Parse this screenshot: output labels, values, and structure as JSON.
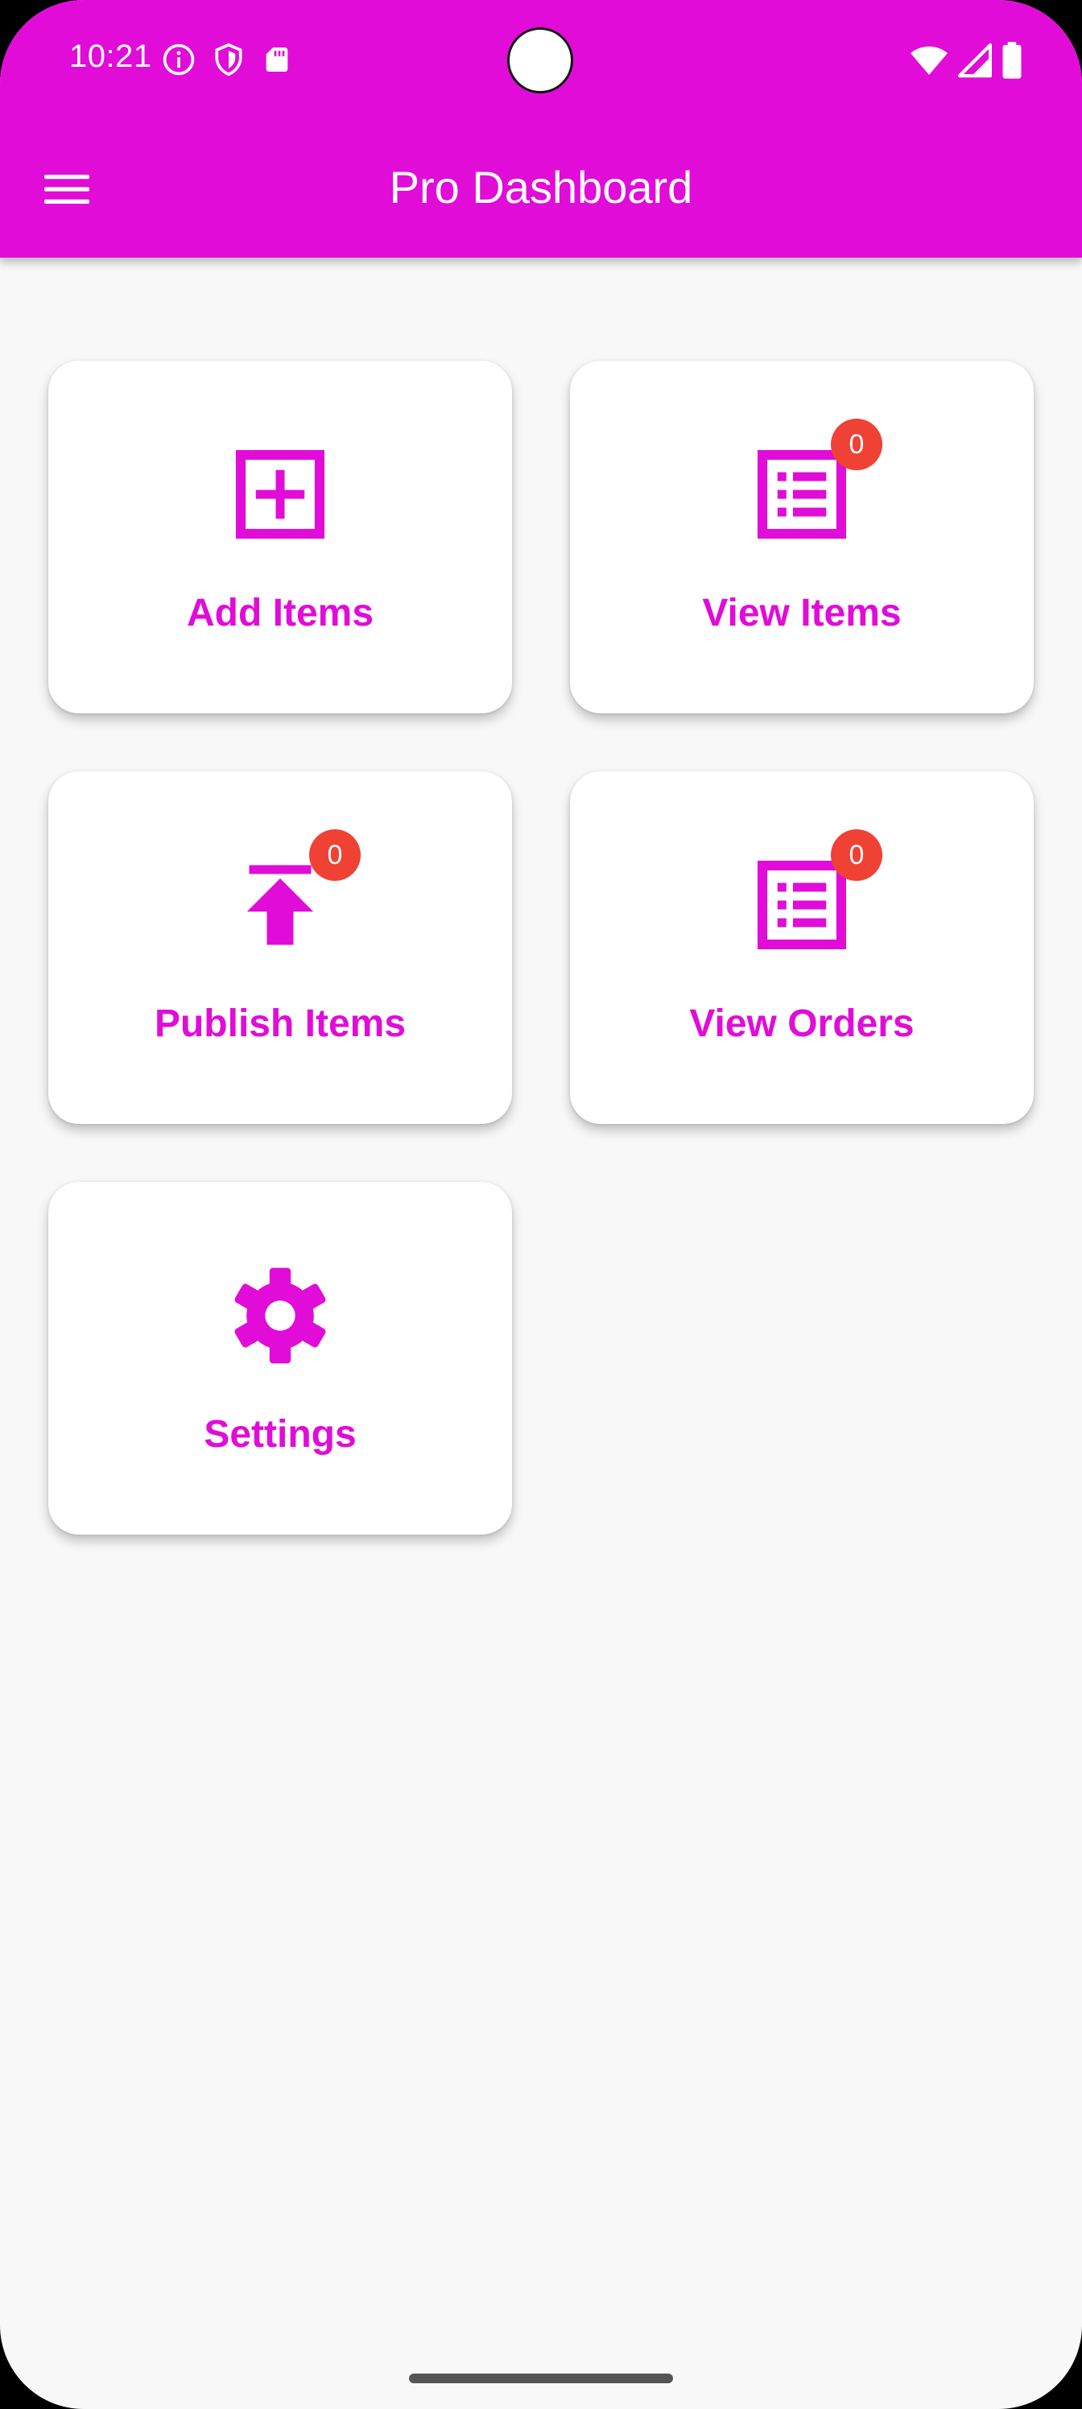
{
  "status_bar": {
    "time": "10:21",
    "left_icons": [
      "info-icon",
      "shield-icon",
      "sd-card-icon"
    ],
    "right_icons": [
      "wifi-icon",
      "signal-icon",
      "battery-icon"
    ]
  },
  "toolbar": {
    "title": "Pro Dashboard",
    "menu_icon": "hamburger-menu-icon"
  },
  "colors": {
    "accent": "#e10cd8",
    "background": "#f8f8f8",
    "card": "#ffffff",
    "badge": "#f04135",
    "text_on_accent": "#ffffff"
  },
  "cards": [
    {
      "label": "Add Items",
      "icon": "add-box-icon",
      "badge": null
    },
    {
      "label": "View Items",
      "icon": "list-icon",
      "badge": "0"
    },
    {
      "label": "Publish Items",
      "icon": "publish-icon",
      "badge": "0"
    },
    {
      "label": "View Orders",
      "icon": "list-icon",
      "badge": "0"
    },
    {
      "label": "Settings",
      "icon": "gear-icon",
      "badge": null
    }
  ]
}
